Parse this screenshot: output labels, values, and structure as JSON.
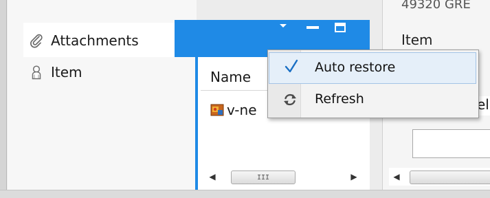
{
  "window": {
    "header_partial_text": "49320 GRE",
    "right_item_label": "Item",
    "right_partial_text": "el"
  },
  "nav": {
    "items": [
      {
        "label": "Attachments",
        "icon": "paperclip-icon",
        "selected": true
      },
      {
        "label": "Item",
        "icon": "user-icon",
        "selected": false
      }
    ]
  },
  "panel_header": {
    "accent_color": "#1f8ae6",
    "controls": [
      "dropdown-menu-icon",
      "minimize-icon",
      "maximize-icon"
    ]
  },
  "table": {
    "columns": [
      "Name"
    ],
    "rows": [
      {
        "name": "v-ne",
        "icon": "file-icon"
      }
    ]
  },
  "context_menu": {
    "items": [
      {
        "label": "Auto restore",
        "icon": "checkmark-icon",
        "checked": true,
        "highlighted": true
      },
      {
        "label": "Refresh",
        "icon": "refresh-icon",
        "checked": false,
        "highlighted": false
      }
    ]
  },
  "scrollbars": {
    "left_arrow": "◀",
    "right_arrow": "▶",
    "grip": "III"
  },
  "colors": {
    "accent": "#1f8ae6",
    "menu_highlight": "#e5eff9",
    "check": "#1a6fc4"
  }
}
